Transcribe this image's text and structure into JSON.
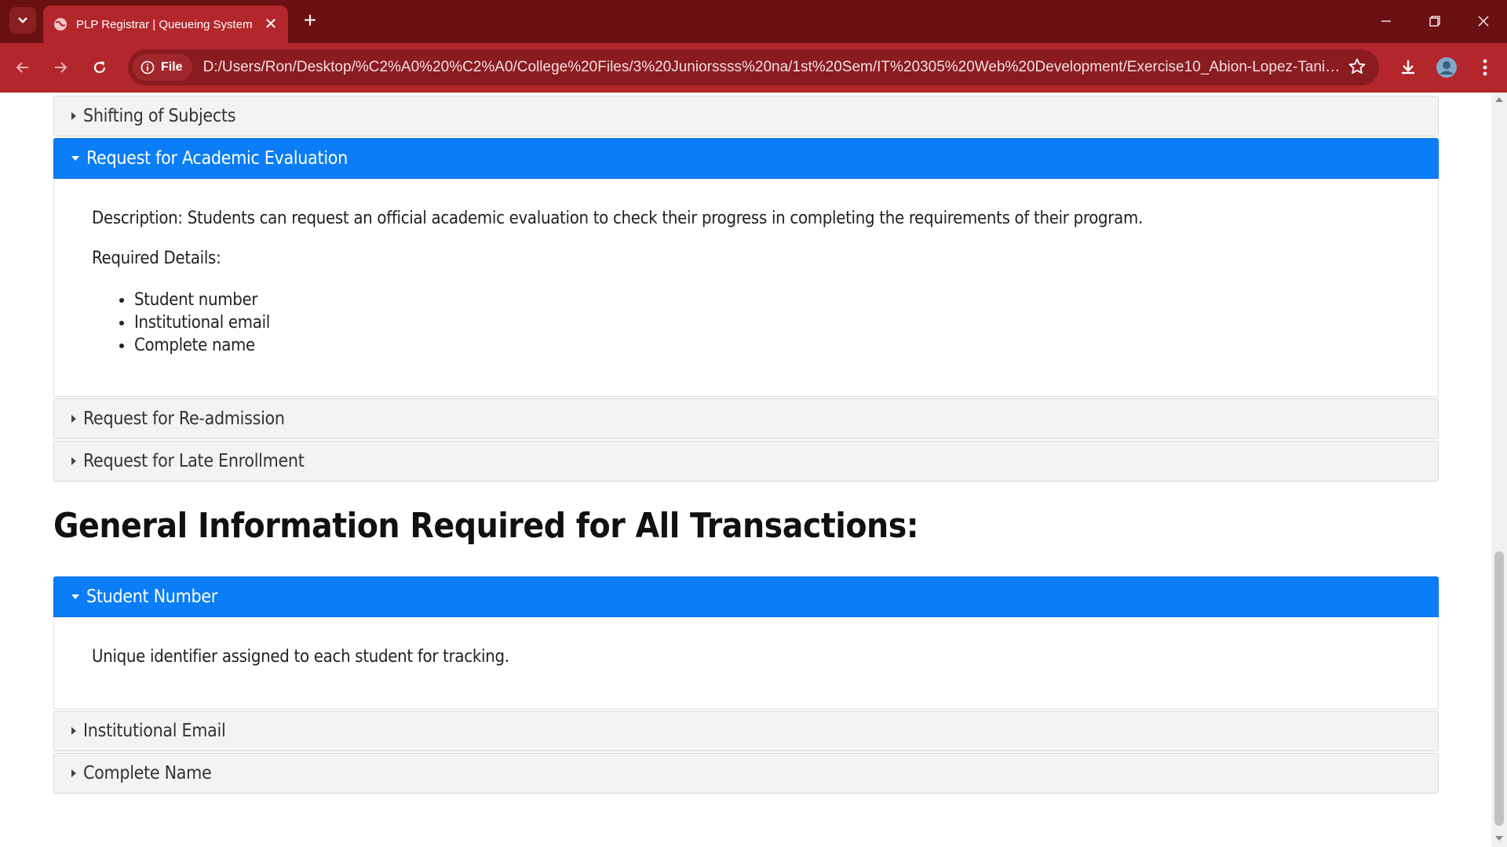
{
  "browser": {
    "tab_title": "PLP Registrar | Queueing System",
    "site_chip_label": "File",
    "url": "D:/Users/Ron/Desktop/%C2%A0%20%C2%A0/College%20Files/3%20Juniorssss%20na/1st%20Sem/IT%20305%20Web%20Development/Exercise10_Abion-Lopez-Taniegra/E..."
  },
  "transactions": [
    {
      "title": "Shifting of Subjects",
      "expanded": false
    },
    {
      "title": "Request for Academic Evaluation",
      "expanded": true,
      "description": "Description: Students can request an official academic evaluation to check their progress in completing the requirements of their program.",
      "required_label": "Required Details:",
      "required_items": [
        "Student number",
        "Institutional email",
        "Complete name"
      ]
    },
    {
      "title": "Request for Re-admission",
      "expanded": false
    },
    {
      "title": "Request for Late Enrollment",
      "expanded": false
    }
  ],
  "general_info": {
    "heading": "General Information Required for All Transactions:",
    "items": [
      {
        "title": "Student Number",
        "expanded": true,
        "body": "Unique identifier assigned to each student for tracking."
      },
      {
        "title": "Institutional Email",
        "expanded": false
      },
      {
        "title": "Complete Name",
        "expanded": false
      }
    ]
  },
  "colors": {
    "tabbar": "#6b1012",
    "toolbar": "#b3262b",
    "accordion_active": "#0a7df7"
  }
}
